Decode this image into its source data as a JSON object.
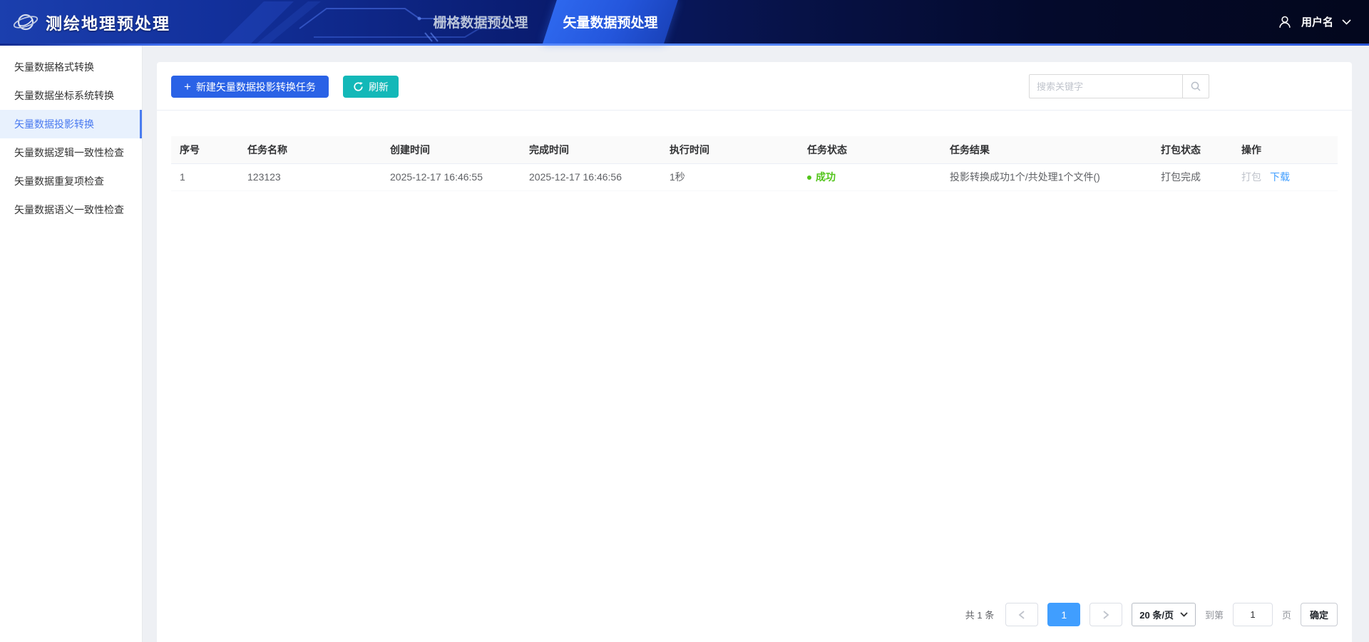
{
  "header": {
    "logo_title": "测绘地理预处理",
    "tabs": [
      {
        "label": "栅格数据预处理",
        "active": false
      },
      {
        "label": "矢量数据预处理",
        "active": true
      }
    ],
    "user": {
      "name": "用户名"
    }
  },
  "sidebar": {
    "items": [
      {
        "label": "矢量数据格式转换",
        "active": false
      },
      {
        "label": "矢量数据坐标系统转换",
        "active": false
      },
      {
        "label": "矢量数据投影转换",
        "active": true
      },
      {
        "label": "矢量数据逻辑一致性检查",
        "active": false
      },
      {
        "label": "矢量数据重复项检查",
        "active": false
      },
      {
        "label": "矢量数据语义一致性检查",
        "active": false
      }
    ]
  },
  "toolbar": {
    "new_task_label": "新建矢量数据投影转换任务",
    "refresh_label": "刷新",
    "search_placeholder": "搜索关键字"
  },
  "table": {
    "columns": [
      "序号",
      "任务名称",
      "创建时间",
      "完成时间",
      "执行时间",
      "任务状态",
      "任务结果",
      "打包状态",
      "操作"
    ],
    "rows": [
      {
        "index": "1",
        "task_name": "123123",
        "created_at": "2025-12-17 16:46:55",
        "finished_at": "2025-12-17 16:46:56",
        "duration": "1秒",
        "status": "成功",
        "result": "投影转换成功1个/共处理1个文件()",
        "package_status": "打包完成",
        "action_package": "打包",
        "action_download": "下载"
      }
    ]
  },
  "pagination": {
    "total": "共 1 条",
    "current_page": "1",
    "page_size": "20 条/页",
    "goto_prefix": "到第",
    "goto_value": "1",
    "goto_suffix": "页",
    "confirm": "确定"
  },
  "colors": {
    "primary_blue": "#2a62e6",
    "teal": "#13b8b8",
    "success_green": "#52c41a",
    "link_blue": "#409eff",
    "active_menu_blue": "#4a7af0"
  }
}
